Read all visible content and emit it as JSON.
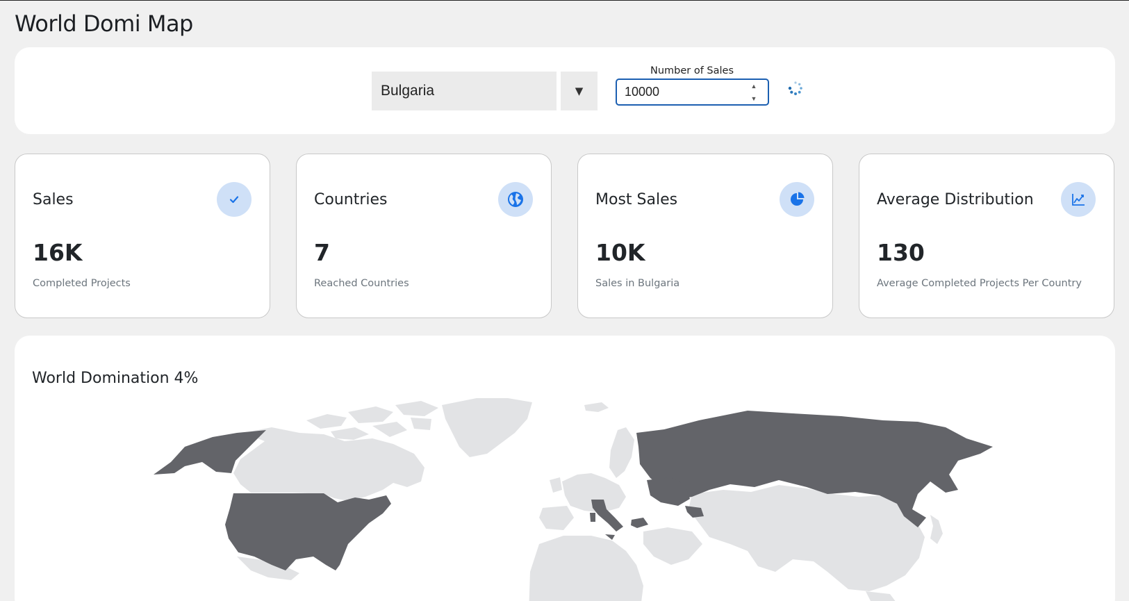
{
  "page": {
    "title": "World Domi Map"
  },
  "controls": {
    "country_selected": "Bulgaria",
    "dropdown_arrow": "▼",
    "sales_label": "Number of Sales",
    "sales_value": "10000",
    "spinner_up": "▲",
    "spinner_down": "▼",
    "loading_icon": "loading-spinner-icon"
  },
  "cards": [
    {
      "title": "Sales",
      "value": "16K",
      "subtitle": "Completed Projects",
      "icon": "check-icon"
    },
    {
      "title": "Countries",
      "value": "7",
      "subtitle": "Reached Countries",
      "icon": "globe-icon"
    },
    {
      "title": "Most Sales",
      "value": "10K",
      "subtitle": "Sales in Bulgaria",
      "icon": "pie-chart-icon"
    },
    {
      "title": "Average Distribution",
      "value": "130",
      "subtitle": "Average Completed Projects Per Country",
      "icon": "line-chart-icon"
    }
  ],
  "map": {
    "title": "World Domination 4%",
    "reached_countries": [
      "Alaska",
      "United States",
      "Russia",
      "Italy",
      "Bulgaria",
      "Ukraine",
      "Georgia"
    ],
    "colors": {
      "reached": "#636469",
      "unreached": "#e2e3e5",
      "accent": "#1a73e8",
      "icon_bg": "#cfe0f7"
    }
  }
}
